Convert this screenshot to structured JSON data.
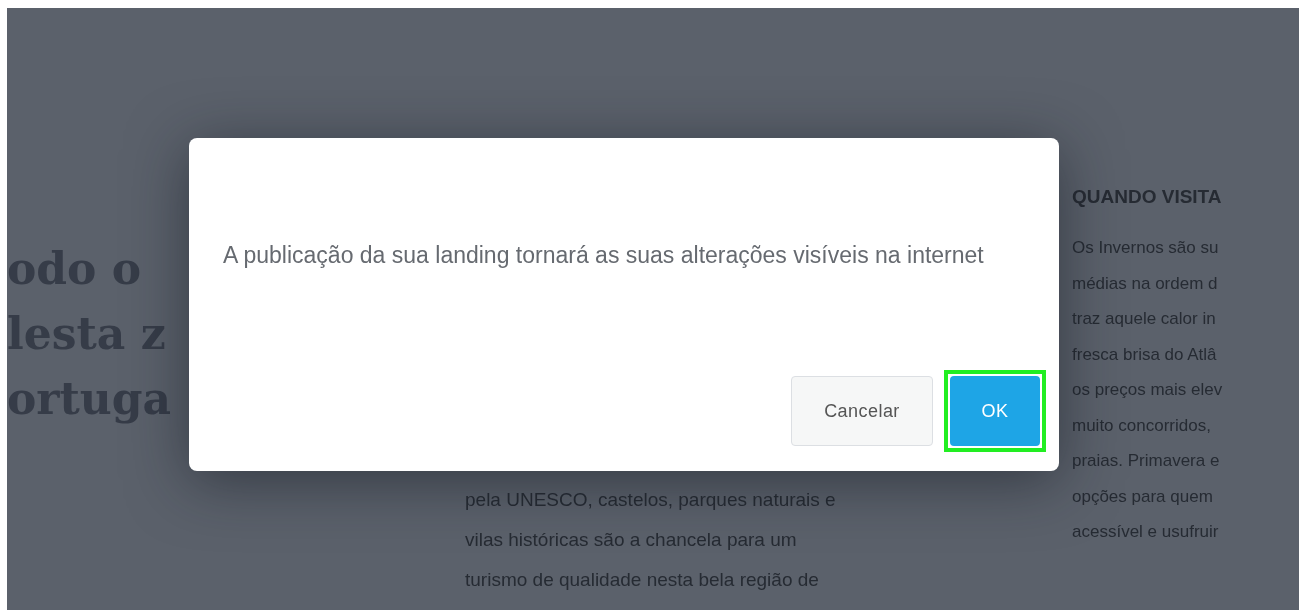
{
  "page": {
    "heading_lines": [
      "odo o",
      "lesta z",
      "ortuga"
    ],
    "middle_lines": [
      "pela UNESCO, castelos, parques naturais e",
      "vilas históricas são a chancela para um",
      "turismo de qualidade nesta bela região de"
    ],
    "side_heading": "QUANDO VISITA",
    "side_lines": [
      "Os Invernos são su",
      "médias na ordem d",
      "traz aquele calor in",
      "fresca brisa do Atlâ",
      "os preços mais elev",
      "muito concorridos,",
      "praias. Primavera e",
      "opções para quem",
      "acessível e usufruir"
    ]
  },
  "dialog": {
    "message": "A publicação da sua landing tornará as suas alterações visíveis na internet",
    "buttons": [
      {
        "label": "Cancelar",
        "kind": "secondary",
        "focused": false
      },
      {
        "label": "OK",
        "kind": "primary",
        "focused": true
      }
    ]
  }
}
